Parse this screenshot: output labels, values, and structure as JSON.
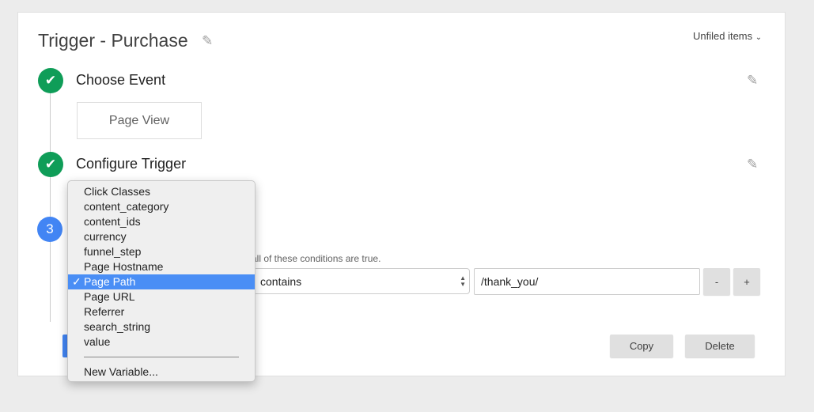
{
  "header": {
    "title": "Trigger - Purchase",
    "folder": "Unfiled items"
  },
  "steps": [
    {
      "number": "1",
      "title": "Choose Event",
      "status": "complete",
      "value": "Page View"
    },
    {
      "number": "2",
      "title": "Configure Trigger",
      "status": "complete"
    },
    {
      "number": "3",
      "status": "active"
    }
  ],
  "condition": {
    "hint": "all of these conditions are true.",
    "operator": "contains",
    "value": "/thank_you/",
    "remove_label": "-",
    "add_label": "+"
  },
  "actions": {
    "copy": "Copy",
    "delete": "Delete"
  },
  "dropdown": {
    "items": [
      "Click Classes",
      "content_category",
      "content_ids",
      "currency",
      "funnel_step",
      "Page Hostname",
      "Page Path",
      "Page URL",
      "Referrer",
      "search_string",
      "value"
    ],
    "selected": "Page Path",
    "check": "✓",
    "new_variable": "New Variable..."
  },
  "colors": {
    "complete": "#0f9d58",
    "active": "#4285f4",
    "highlight": "#4a8ef5"
  }
}
